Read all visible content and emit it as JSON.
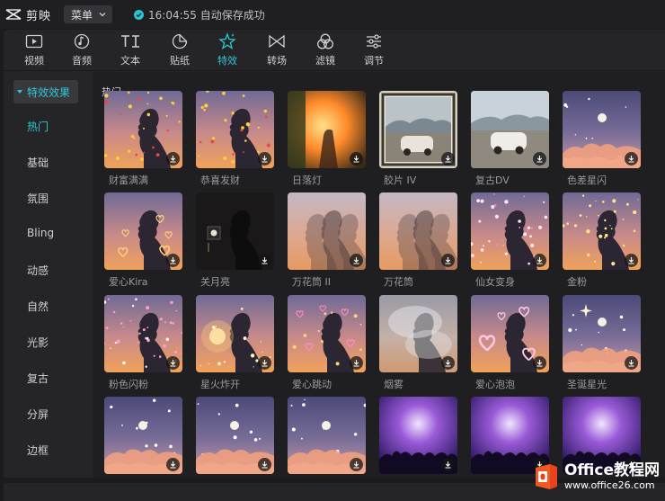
{
  "app": {
    "name": "剪映",
    "menu_label": "菜单",
    "save_status": "16:04:55 自动保存成功",
    "accent": "#2ec8d3"
  },
  "toolbar": {
    "tools": [
      {
        "label": "视频",
        "icon": "video-icon"
      },
      {
        "label": "音频",
        "icon": "audio-icon"
      },
      {
        "label": "文本",
        "icon": "text-icon"
      },
      {
        "label": "贴纸",
        "icon": "sticker-icon"
      },
      {
        "label": "特效",
        "icon": "effects-icon",
        "active": true
      },
      {
        "label": "转场",
        "icon": "transition-icon"
      },
      {
        "label": "滤镜",
        "icon": "filter-icon"
      },
      {
        "label": "调节",
        "icon": "adjust-icon"
      }
    ]
  },
  "sidebar": {
    "header": "特效效果",
    "items": [
      "热门",
      "基础",
      "氛围",
      "Bling",
      "动感",
      "自然",
      "光影",
      "复古",
      "分屏",
      "边框"
    ],
    "active_index": 0
  },
  "grid": {
    "section_title": "热门",
    "effects": [
      {
        "name": "财富满满",
        "theme": "fortune"
      },
      {
        "name": "恭喜发财",
        "theme": "fortune2"
      },
      {
        "name": "日落灯",
        "theme": "sunset-lamp"
      },
      {
        "name": "胶片 IV",
        "theme": "film"
      },
      {
        "name": "复古DV",
        "theme": "retro-dv"
      },
      {
        "name": "色差星闪",
        "theme": "sky-star"
      },
      {
        "name": "爱心Kira",
        "theme": "heart-kira"
      },
      {
        "name": "关月亮",
        "theme": "dark-moon"
      },
      {
        "name": "万花筒 II",
        "theme": "kaleido2"
      },
      {
        "name": "万花筒",
        "theme": "kaleido"
      },
      {
        "name": "仙女变身",
        "theme": "fairy"
      },
      {
        "name": "金粉",
        "theme": "gold"
      },
      {
        "name": "粉色闪粉",
        "theme": "pink-glitter"
      },
      {
        "name": "星火炸开",
        "theme": "spark"
      },
      {
        "name": "爱心跳动",
        "theme": "heart-beat"
      },
      {
        "name": "烟雾",
        "theme": "smoke"
      },
      {
        "name": "爱心泡泡",
        "theme": "heart-bubble"
      },
      {
        "name": "圣诞星光",
        "theme": "xmas-star"
      },
      {
        "name": "",
        "theme": "sky-moon"
      },
      {
        "name": "",
        "theme": "sky-moon"
      },
      {
        "name": "",
        "theme": "sky-moon"
      },
      {
        "name": "",
        "theme": "concert"
      },
      {
        "name": "",
        "theme": "concert"
      },
      {
        "name": "",
        "theme": "concert"
      }
    ]
  },
  "watermark": {
    "line1": "Office教程网",
    "line2": "www.office26.com"
  }
}
